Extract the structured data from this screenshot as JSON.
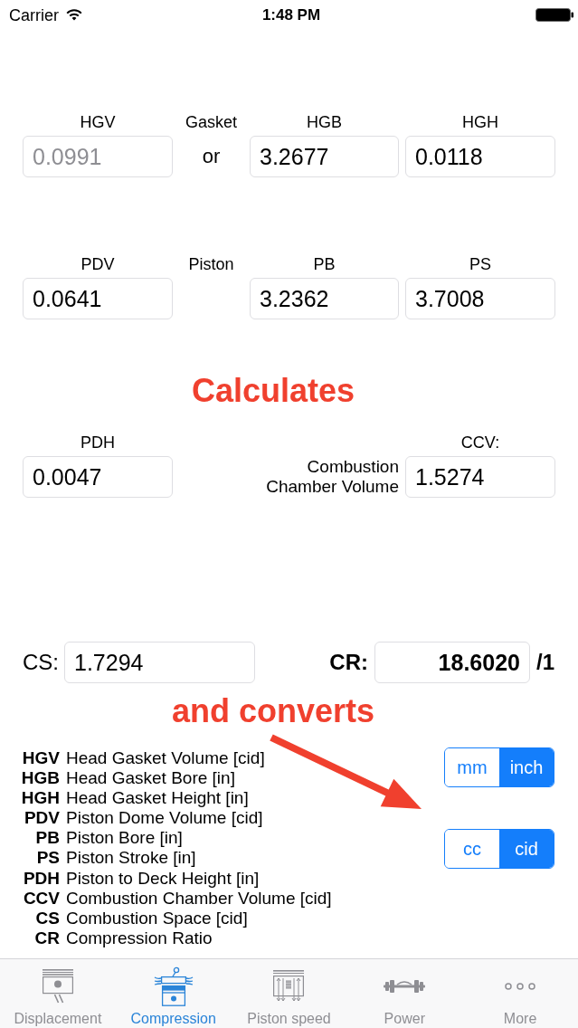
{
  "status_bar": {
    "carrier": "Carrier",
    "time": "1:48 PM"
  },
  "rows": [
    {
      "cells": [
        {
          "kind": "field",
          "label": "HGV",
          "placeholder": "0.0991"
        },
        {
          "kind": "caption",
          "label": "Gasket",
          "connector": "or"
        },
        {
          "kind": "field",
          "label": "HGB",
          "value": "3.2677"
        },
        {
          "kind": "field",
          "label": "HGH",
          "value": "0.0118"
        }
      ]
    },
    {
      "cells": [
        {
          "kind": "field",
          "label": "PDV",
          "value": "0.0641"
        },
        {
          "kind": "caption",
          "label": "Piston"
        },
        {
          "kind": "field",
          "label": "PB",
          "value": "3.2362"
        },
        {
          "kind": "field",
          "label": "PS",
          "value": "3.7008"
        }
      ]
    },
    {
      "heading": "Calculates",
      "cells": [
        {
          "kind": "field",
          "label": "PDH",
          "value": "0.0047"
        },
        {
          "kind": "note",
          "text": "Combustion Chamber Volume"
        },
        {
          "kind": "field",
          "label": "CCV:",
          "value": "1.5274"
        }
      ]
    }
  ],
  "results": [
    {
      "label": "CS:",
      "value": "1.7294",
      "emphasis": false
    },
    {
      "label": "CR:",
      "value": "18.6020",
      "emphasis": true,
      "suffix": "/1"
    }
  ],
  "reference": {
    "heading": "and converts",
    "legend": [
      {
        "abbr": "HGV",
        "text": "Head Gasket Volume [cid]"
      },
      {
        "abbr": "HGB",
        "text": "Head Gasket Bore [in]"
      },
      {
        "abbr": "HGH",
        "text": "Head Gasket Height [in]"
      },
      {
        "abbr": "PDV",
        "text": "Piston Dome Volume [cid]"
      },
      {
        "abbr": "PB",
        "text": "Piston Bore [in]"
      },
      {
        "abbr": "PS",
        "text": "Piston Stroke [in]"
      },
      {
        "abbr": "PDH",
        "text": "Piston to Deck Height [in]"
      },
      {
        "abbr": "CCV",
        "text": "Combustion Chamber Volume [cid]"
      },
      {
        "abbr": "CS",
        "text": "Combustion Space [cid]"
      },
      {
        "abbr": "CR",
        "text": "Compression Ratio"
      }
    ],
    "unit_toggles": [
      {
        "options": [
          {
            "label": "mm",
            "selected": false
          },
          {
            "label": "inch",
            "selected": true
          }
        ]
      },
      {
        "options": [
          {
            "label": "cc",
            "selected": false
          },
          {
            "label": "cid",
            "selected": true
          }
        ]
      }
    ]
  },
  "tab_bar": [
    {
      "label": "Displacement",
      "selected": false
    },
    {
      "label": "Compression",
      "selected": true
    },
    {
      "label": "Piston speed",
      "selected": false
    },
    {
      "label": "Power",
      "selected": false
    },
    {
      "label": "More",
      "selected": false
    }
  ]
}
